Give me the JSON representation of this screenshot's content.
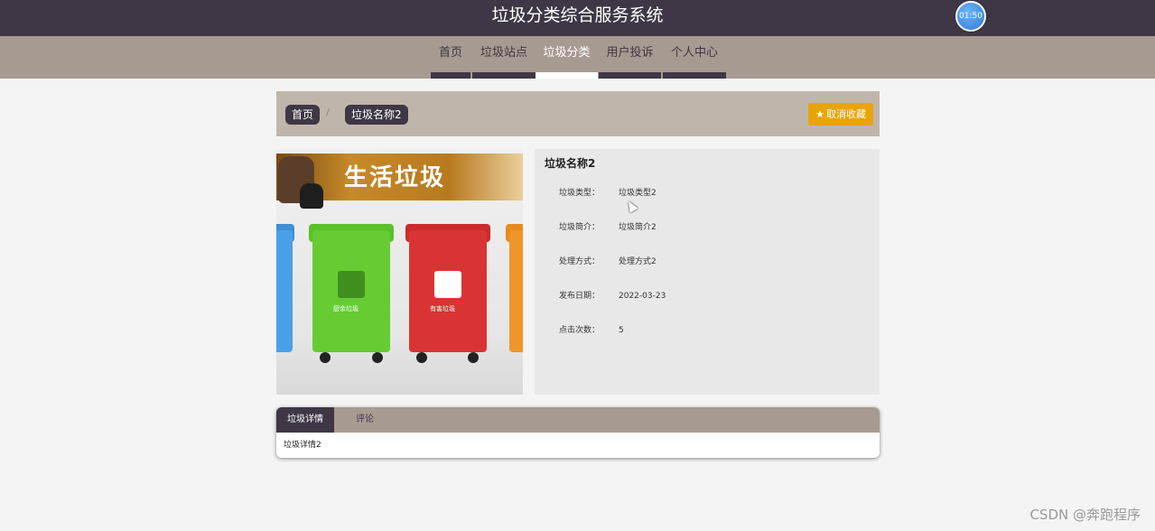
{
  "header": {
    "title": "垃圾分类综合服务系统",
    "clock": "01:50"
  },
  "nav": {
    "items": [
      {
        "label": "首页",
        "active": false
      },
      {
        "label": "垃圾站点",
        "active": false
      },
      {
        "label": "垃圾分类",
        "active": true
      },
      {
        "label": "用户投诉",
        "active": false
      },
      {
        "label": "个人中心",
        "active": false
      }
    ]
  },
  "breadcrumb": {
    "home": "首页",
    "separator": "/",
    "current": "垃圾名称2"
  },
  "favorite_button": {
    "icon": "star-icon",
    "label": "取消收藏"
  },
  "image": {
    "banner_text": "生活垃圾",
    "bin_labels": [
      "厨余垃圾",
      "有害垃圾"
    ]
  },
  "detail": {
    "title": "垃圾名称2",
    "fields": [
      {
        "key": "垃圾类型：",
        "value": "垃圾类型2"
      },
      {
        "key": "垃圾简介：",
        "value": "垃圾简介2"
      },
      {
        "key": "处理方式：",
        "value": "处理方式2"
      },
      {
        "key": "发布日期：",
        "value": "2022-03-23"
      },
      {
        "key": "点击次数：",
        "value": "5"
      }
    ]
  },
  "tabs": {
    "items": [
      {
        "label": "垃圾详情",
        "active": true
      },
      {
        "label": "评论",
        "active": false
      }
    ],
    "content": "垃圾详情2"
  },
  "watermark": "CSDN @奔跑程序",
  "colors": {
    "dark": "#3f3745",
    "nav_bg": "#a79a91",
    "crumb_bg": "#bfb6ab",
    "accent": "#e9a40a"
  }
}
